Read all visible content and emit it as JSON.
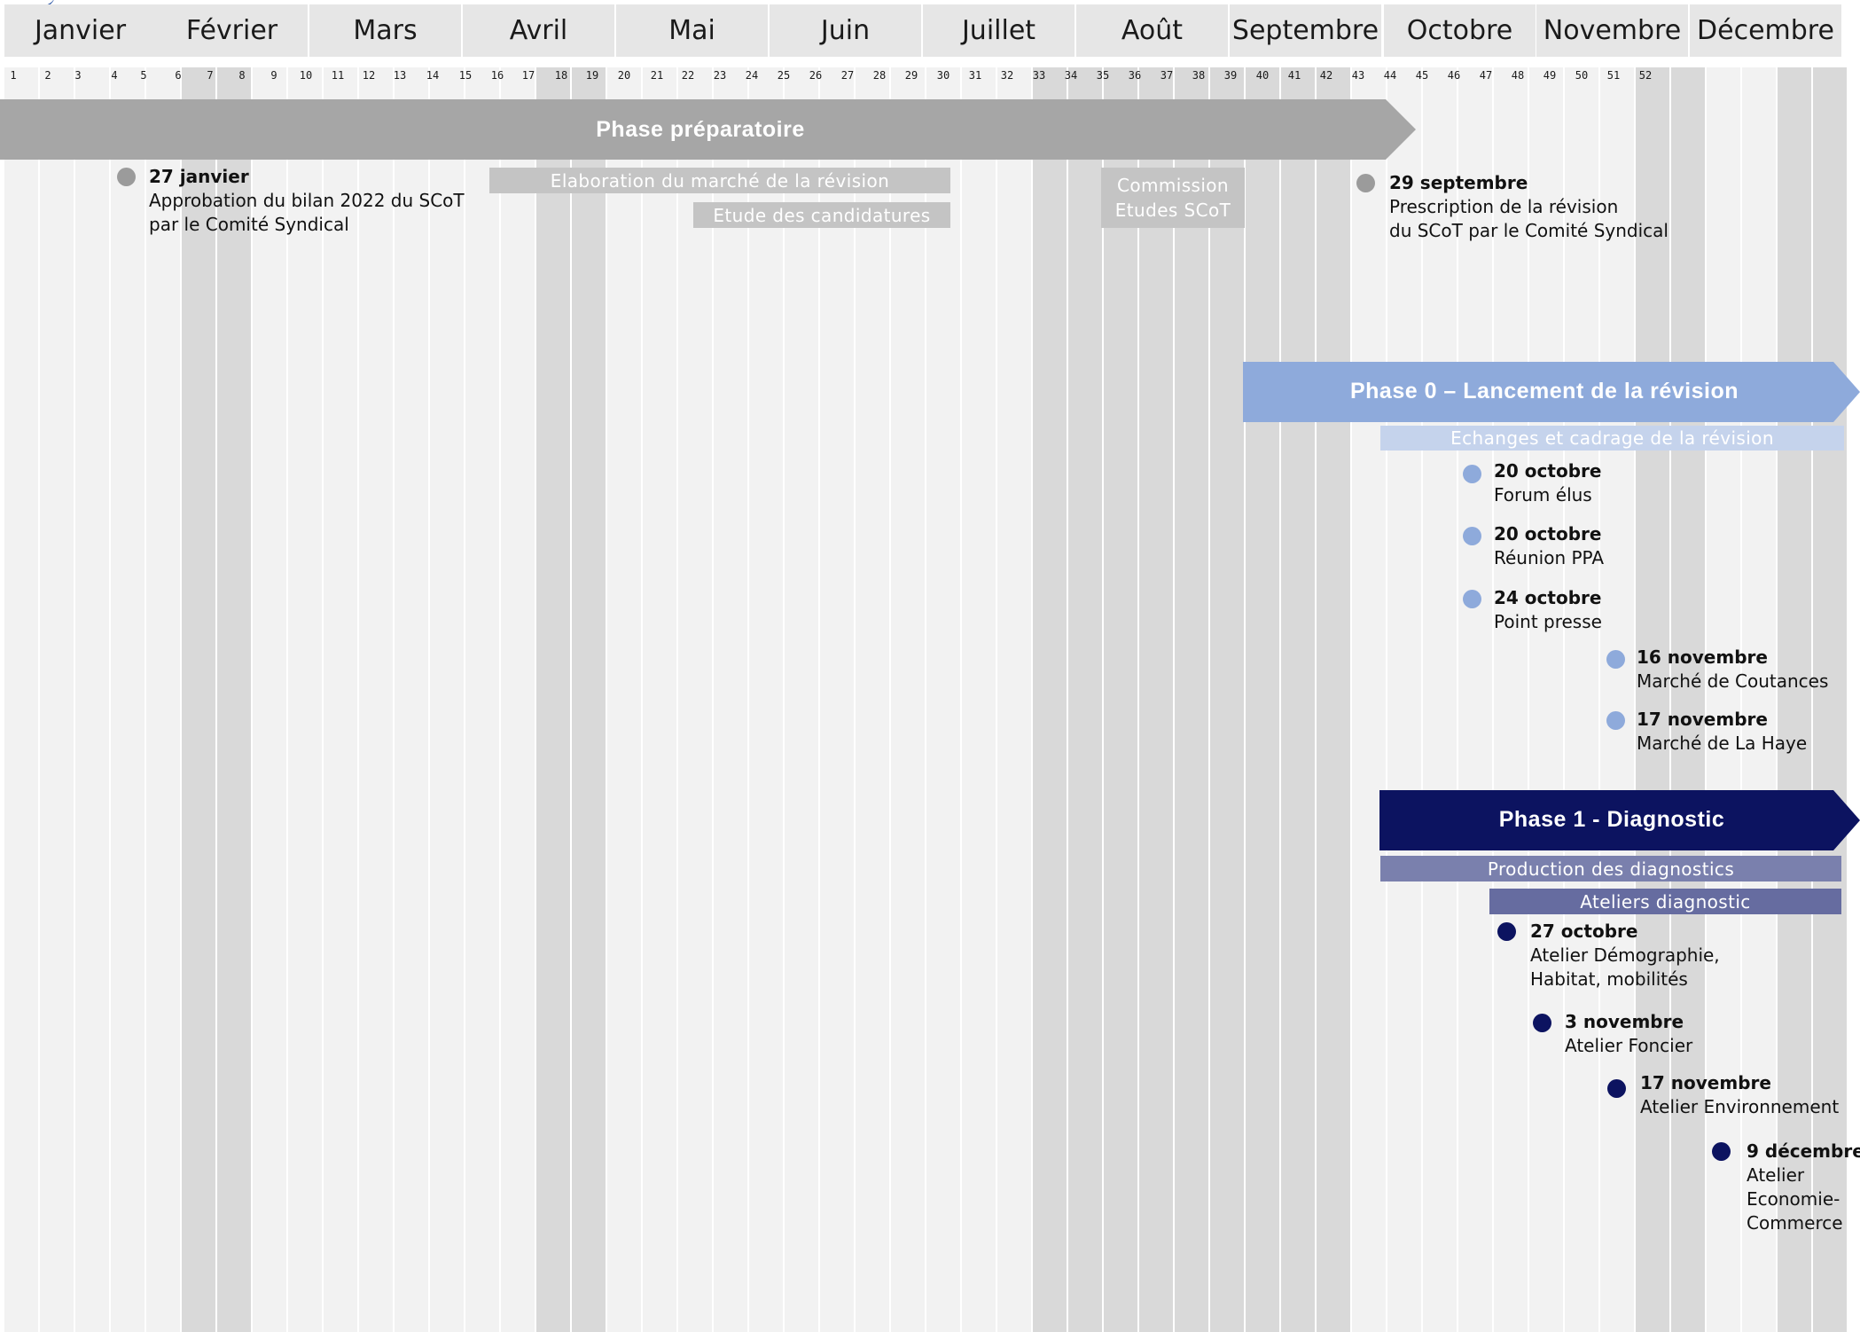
{
  "months": [
    "Janvier",
    "Février",
    "Mars",
    "Avril",
    "Mai",
    "Juin",
    "Juillet",
    "Août",
    "Septembre",
    "Octobre",
    "Novembre",
    "Décembre"
  ],
  "weeks": [
    "1",
    "2",
    "3",
    "4",
    "5",
    "6",
    "7",
    "8",
    "9",
    "10",
    "11",
    "12",
    "13",
    "14",
    "15",
    "16",
    "17",
    "18",
    "19",
    "20",
    "21",
    "22",
    "23",
    "24",
    "25",
    "26",
    "27",
    "28",
    "29",
    "30",
    "31",
    "32",
    "33",
    "34",
    "35",
    "36",
    "37",
    "38",
    "39",
    "40",
    "41",
    "42",
    "43",
    "44",
    "45",
    "46",
    "47",
    "48",
    "49",
    "50",
    "51",
    "52"
  ],
  "colors": {
    "month_bg": "#e6e6e6",
    "col_light": "#f2f2f2",
    "col_dark": "#d9d9d9",
    "phase_prep": "#a6a6a6",
    "phase0": "#8eaadb",
    "phase1": "#0c1360",
    "grey_dot": "#9b9b9b",
    "light_blue_dot": "#8eaadb",
    "navy_dot": "#0c1360"
  },
  "phases": {
    "prep": {
      "label": "Phase préparatoire"
    },
    "p0": {
      "label": "Phase 0 – Lancement de la révision"
    },
    "p1": {
      "label": "Phase 1 - Diagnostic"
    }
  },
  "bars": {
    "marche": "Elaboration du marché de la révision",
    "candidatures": "Etude des candidatures",
    "commission": "Commission\nEtudes SCoT",
    "echanges": "Echanges et cadrage de la révision",
    "production": "Production des diagnostics",
    "ateliers": "Ateliers diagnostic"
  },
  "events": [
    {
      "date": "27 janvier",
      "label": "Approbation du bilan 2022 du SCoT\npar le Comité Syndical",
      "color": "grey"
    },
    {
      "date": "29 septembre",
      "label": "Prescription de la révision\ndu SCoT par le Comité Syndical",
      "color": "grey"
    },
    {
      "date": "20 octobre",
      "label": "Forum élus",
      "color": "light"
    },
    {
      "date": "20 octobre",
      "label": "Réunion PPA",
      "color": "light"
    },
    {
      "date": "24 octobre",
      "label": "Point presse",
      "color": "light"
    },
    {
      "date": "16 novembre",
      "label": "Marché de Coutances",
      "color": "light"
    },
    {
      "date": "17 novembre",
      "label": "Marché de La Haye",
      "color": "light"
    },
    {
      "date": "27 octobre",
      "label": "Atelier Démographie,\nHabitat, mobilités",
      "color": "navy"
    },
    {
      "date": "3 novembre",
      "label": "Atelier Foncier",
      "color": "navy"
    },
    {
      "date": "17 novembre",
      "label": "Atelier Environnement",
      "color": "navy"
    },
    {
      "date": "9 décembre",
      "label": "Atelier\nEconomie-\nCommerce",
      "color": "navy"
    }
  ]
}
